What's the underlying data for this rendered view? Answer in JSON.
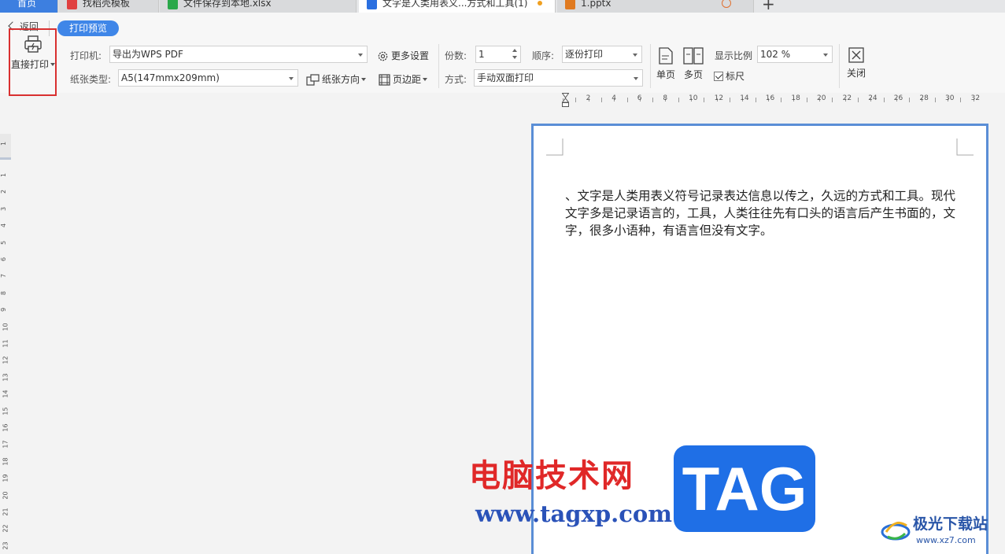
{
  "tabs": [
    {
      "label": "首页",
      "icon": "home-icon"
    },
    {
      "label": "找稻壳模板",
      "icon": "docer-icon",
      "color": "#e04040"
    },
    {
      "label": "文件保存到本地.xlsx",
      "icon": "spreadsheet-icon",
      "color": "#2aa84a"
    },
    {
      "label": "文字是人类用表义...方式和工具(1)",
      "icon": "writer-icon",
      "color": "#2a6fe0",
      "modified": true
    },
    {
      "label": "1.pptx",
      "icon": "presentation-icon",
      "color": "#e07a20",
      "warning": true
    }
  ],
  "toolbar": {
    "back_label": "返回",
    "mode_label": "打印预览",
    "direct_print_label": "直接打印",
    "printer_label": "打印机:",
    "printer_value": "导出为WPS PDF",
    "paper_type_label": "纸张类型:",
    "paper_type_value": "A5(147mmx209mm)",
    "more_settings_label": "更多设置",
    "orientation_label": "纸张方向",
    "margins_label": "页边距",
    "copies_label": "份数:",
    "copies_value": "1",
    "order_label": "顺序:",
    "order_value": "逐份打印",
    "mode_label2": "方式:",
    "mode_value": "手动双面打印",
    "single_page_label": "单页",
    "multi_page_label": "多页",
    "zoom_label": "显示比例",
    "zoom_value": "102 %",
    "ruler_label": "标尺",
    "ruler_checked": true,
    "close_label": "关闭"
  },
  "ruler_h": [
    "2",
    "4",
    "6",
    "8",
    "10",
    "12",
    "14",
    "16",
    "18",
    "20",
    "22",
    "24",
    "26",
    "28",
    "30",
    "32"
  ],
  "ruler_v": [
    "1",
    "1",
    "2",
    "3",
    "4",
    "5",
    "6",
    "7",
    "8",
    "9",
    "10",
    "11",
    "12",
    "13",
    "14",
    "15",
    "16",
    "17",
    "18",
    "19",
    "20",
    "21",
    "22",
    "23"
  ],
  "document": {
    "text": "、文字是人类用表义符号记录表达信息以传之，久远的方式和工具。现代文字多是记录语言的，工具，人类往往先有口头的语言后产生书面的，文字，很多小语种，有语言但没有文字。"
  },
  "watermark": {
    "site_cn": "电脑技术网",
    "site_url": "www.tagxp.com",
    "tag": "TAG",
    "logo_name": "极光下载站",
    "logo_url": "www.xz7.com"
  },
  "colors": {
    "accent": "#3f86e8",
    "highlight_box": "#d93030",
    "page_border": "#5a8ed6"
  }
}
